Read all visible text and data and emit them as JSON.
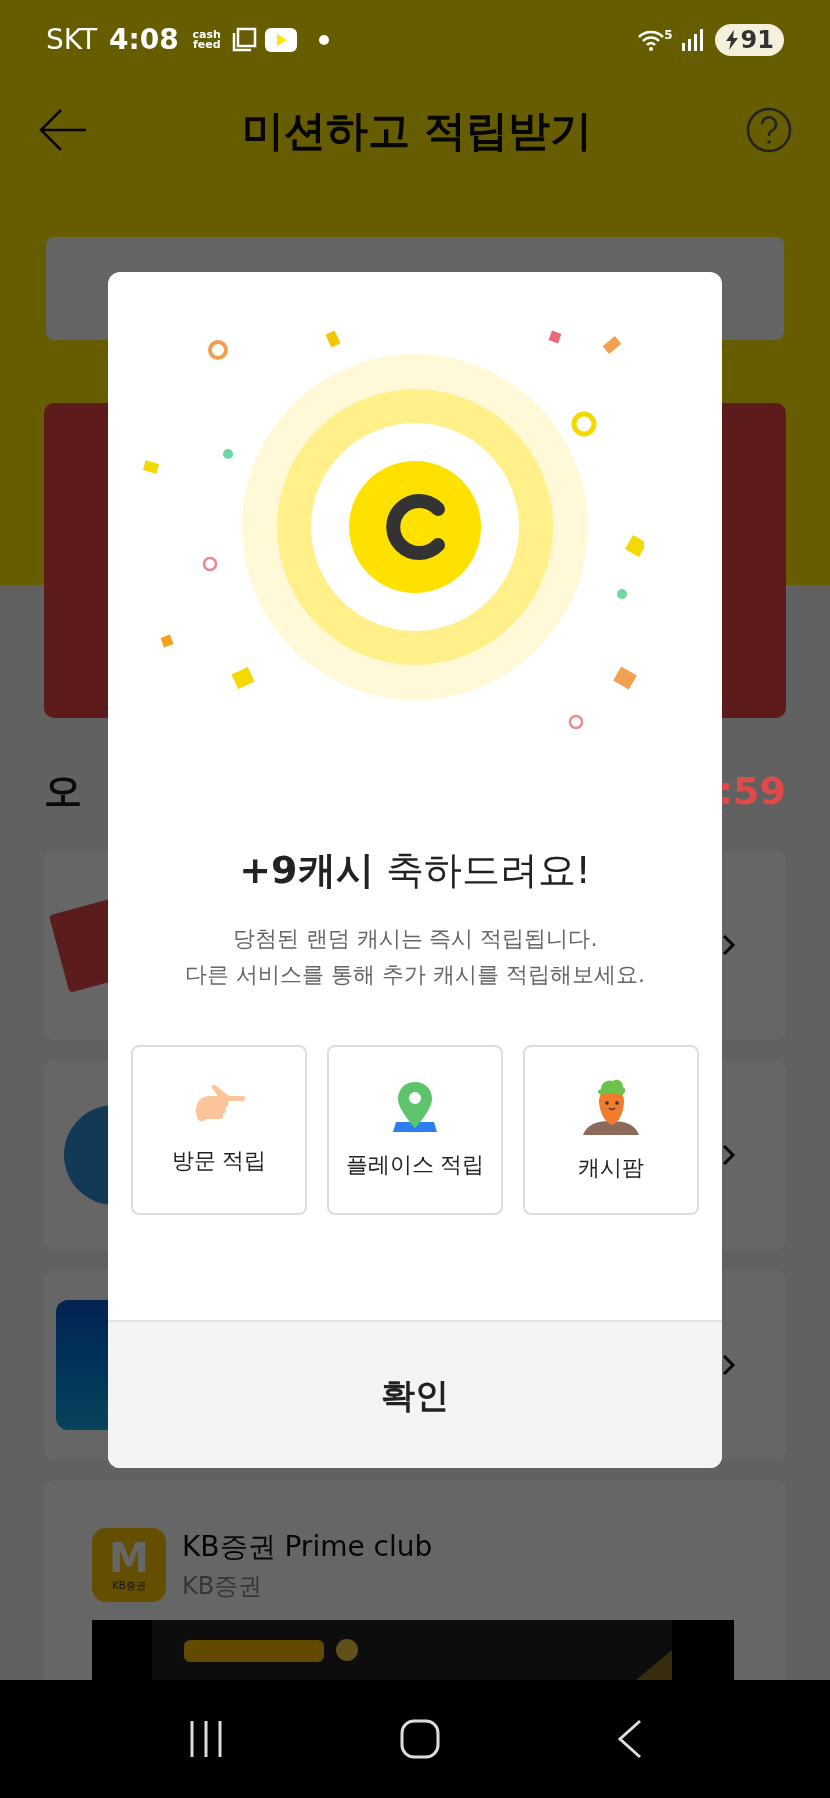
{
  "status_bar": {
    "carrier": "SKT",
    "time": "4:08",
    "app_badge": "cash feed",
    "network": "5",
    "battery": "91"
  },
  "header": {
    "title": "미션하고 적립받기"
  },
  "section": {
    "title": "오",
    "timer": ":59"
  },
  "mission_cards": [
    {
      "kind": "ticket"
    },
    {
      "kind": "circle"
    },
    {
      "kind": "tile"
    }
  ],
  "kb_card": {
    "logo_letter": "M",
    "logo_caption": "KB증권",
    "title": "KB증권 Prime club",
    "subtitle": "KB증권"
  },
  "dialog": {
    "reward": "+9캐시",
    "title_rest": "축하드려요!",
    "message_lines": [
      "당첨된 랜덤 캐시는 즉시 적립됩니다.",
      "다른 서비스를 통해 추가 캐시를 적립해보세요."
    ],
    "shortcuts": [
      {
        "label": "방문 적립",
        "kind": "hand"
      },
      {
        "label": "플레이스 적립",
        "kind": "pin"
      },
      {
        "label": "캐시팜",
        "kind": "carrot"
      }
    ],
    "confirm": "확인"
  }
}
